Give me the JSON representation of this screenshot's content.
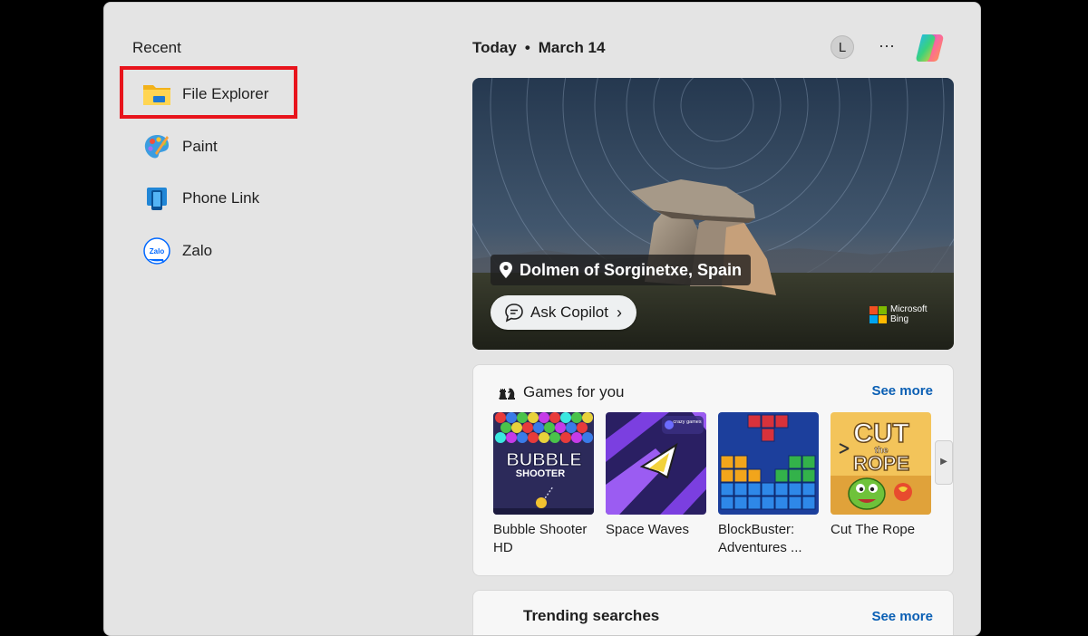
{
  "recent": {
    "title": "Recent",
    "items": [
      {
        "label": "File Explorer",
        "icon": "folder-icon"
      },
      {
        "label": "Paint",
        "icon": "paint-palette-icon"
      },
      {
        "label": "Phone Link",
        "icon": "phone-link-icon"
      },
      {
        "label": "Zalo",
        "icon": "zalo-icon"
      }
    ]
  },
  "header": {
    "today": "Today",
    "separator": "•",
    "date": "March 14",
    "avatar_initial": "L",
    "more": "···"
  },
  "hero": {
    "location": "Dolmen of Sorginetxe, Spain",
    "ask_label": "Ask Copilot",
    "ask_chevron": "›",
    "bing_line1": "Microsoft",
    "bing_line2": "Bing"
  },
  "games": {
    "title": "Games for you",
    "see_more": "See more",
    "items": [
      {
        "name": "Bubble Shooter HD",
        "thumb_title1": "BUBBLE",
        "thumb_title2": "SHOOTER"
      },
      {
        "name": "Space Waves",
        "thumb_badge": "crazy games"
      },
      {
        "name": "BlockBuster: Adventures ..."
      },
      {
        "name": "Cut The Rope",
        "thumb_title1": "CUT",
        "thumb_title2": "the",
        "thumb_title3": "ROPE"
      }
    ],
    "next_arrow": "▶"
  },
  "next_card": {
    "title": "Trending searches",
    "see_more": "See more"
  },
  "colors": {
    "panel_bg": "#e4e4e4",
    "highlight": "#e8141c",
    "link": "#0a5fb4"
  }
}
